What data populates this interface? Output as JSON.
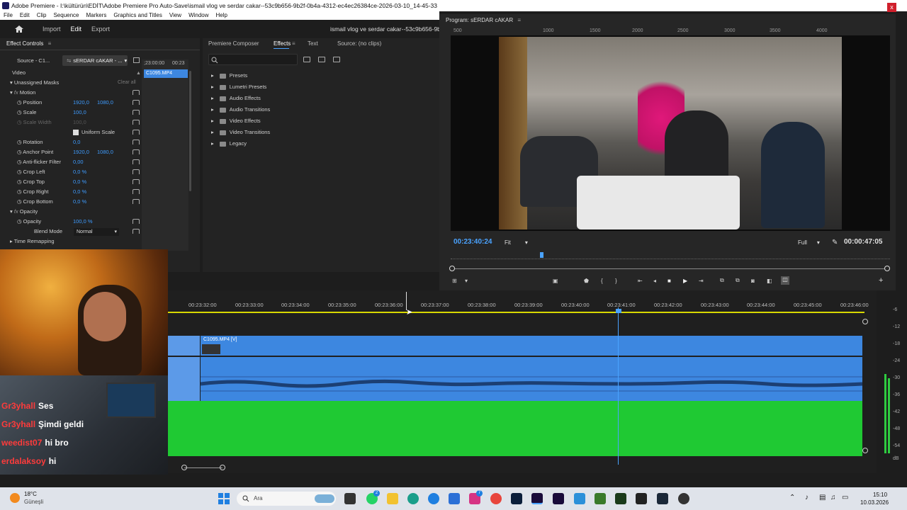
{
  "window": {
    "title": "Adobe Premiere - I:\\kültürün\\EDİT\\Adobe Premiere Pro Auto-Save\\ismail vlog ve serdar cakar--53c9b656-9b2f-0b4a-4312-ec4ec26384ce-2026-03-10_14-45-33",
    "close_glyph": "x"
  },
  "menu": [
    "File",
    "Edit",
    "Clip",
    "Sequence",
    "Markers",
    "Graphics and Titles",
    "View",
    "Window",
    "Help"
  ],
  "workspaces": [
    "Import",
    "Edit",
    "Export"
  ],
  "sequence_title": "ismail vlog ve serdar cakar--53c9b656-9b",
  "effect_controls": {
    "header": "Effect Controls",
    "tab_source": "Source - C1...",
    "tab_sequence": "sERDAR cAKAR - ...",
    "mini_time_a": ";23:00:00",
    "mini_time_b": "00:23",
    "clip_name": "C1095.MP4",
    "section_video": "Video",
    "unassigned_masks": "Unassigned Masks",
    "clear_all": "Clear all",
    "rows": [
      {
        "label": "Motion",
        "v1": "",
        "v2": ""
      },
      {
        "label": "Position",
        "v1": "1920,0",
        "v2": "1080,0"
      },
      {
        "label": "Scale",
        "v1": "100,0",
        "v2": ""
      },
      {
        "label": "Scale Width",
        "v1": "100,0",
        "v2": ""
      },
      {
        "label": "Uniform Scale",
        "v1": "",
        "v2": ""
      },
      {
        "label": "Rotation",
        "v1": "0,0",
        "v2": ""
      },
      {
        "label": "Anchor Point",
        "v1": "1920,0",
        "v2": "1080,0"
      },
      {
        "label": "Anti-flicker Filter",
        "v1": "0,00",
        "v2": ""
      },
      {
        "label": "Crop Left",
        "v1": "0,0 %",
        "v2": ""
      },
      {
        "label": "Crop Top",
        "v1": "0,0 %",
        "v2": ""
      },
      {
        "label": "Crop Right",
        "v1": "0,0 %",
        "v2": ""
      },
      {
        "label": "Crop Bottom",
        "v1": "0,0 %",
        "v2": ""
      },
      {
        "label": "Opacity",
        "v1": "",
        "v2": ""
      },
      {
        "label": "Opacity",
        "v1": "100,0 %",
        "v2": ""
      },
      {
        "label": "Blend Mode",
        "v1": "Normal",
        "v2": ""
      },
      {
        "label": "Time Remapping",
        "v1": "",
        "v2": ""
      }
    ]
  },
  "effects_panel": {
    "tabs": [
      "Premiere Composer",
      "Effects",
      "Text",
      "Source: (no clips)"
    ],
    "items": [
      "Presets",
      "Lumetri Presets",
      "Audio Effects",
      "Audio Transitions",
      "Video Effects",
      "Video Transitions",
      "Legacy"
    ]
  },
  "program_monitor": {
    "title": "Program: sERDAR cAKAR",
    "ruler_labels": [
      "500",
      "1000",
      "1500",
      "2000",
      "2500",
      "3000",
      "3500",
      "4000"
    ],
    "timecode_current": "00:23:40:24",
    "zoom": "Fit",
    "resolution": "Full",
    "timecode_duration": "00:00:47:05"
  },
  "timeline": {
    "ticks": [
      "00:23:32:00",
      "00:23:33:00",
      "00:23:34:00",
      "00:23:35:00",
      "00:23:36:00",
      "00:23:37:00",
      "00:23:38:00",
      "00:23:39:00",
      "00:23:40:00",
      "00:23:41:00",
      "00:23:42:00",
      "00:23:43:00",
      "00:23:44:00",
      "00:23:45:00",
      "00:23:46:00"
    ],
    "video_clip": "C1095.MP4 [V]"
  },
  "audio_meter": {
    "db_labels": [
      "-6",
      "-12",
      "-18",
      "-24",
      "-30",
      "-36",
      "-42",
      "-48",
      "-54",
      "dB"
    ]
  },
  "chat": [
    {
      "user": "Gr3yhall",
      "message": "Ses"
    },
    {
      "user": "Gr3yhall",
      "message": "Şimdi geldi"
    },
    {
      "user": "weedist07",
      "message": "hi bro"
    },
    {
      "user": "erdalaksoy",
      "message": "hi"
    }
  ],
  "taskbar": {
    "weather_temp": "18°C",
    "weather_label": "Güneşli",
    "search_placeholder": "Ara",
    "time": "15:10",
    "date": "10.03.2026",
    "badge_count": "7"
  },
  "colors": {
    "accent_blue": "#3d87e0",
    "timecode_blue": "#4aa3ff",
    "audio_green": "#1fc933",
    "chat_user_red": "#ff3b3b"
  }
}
